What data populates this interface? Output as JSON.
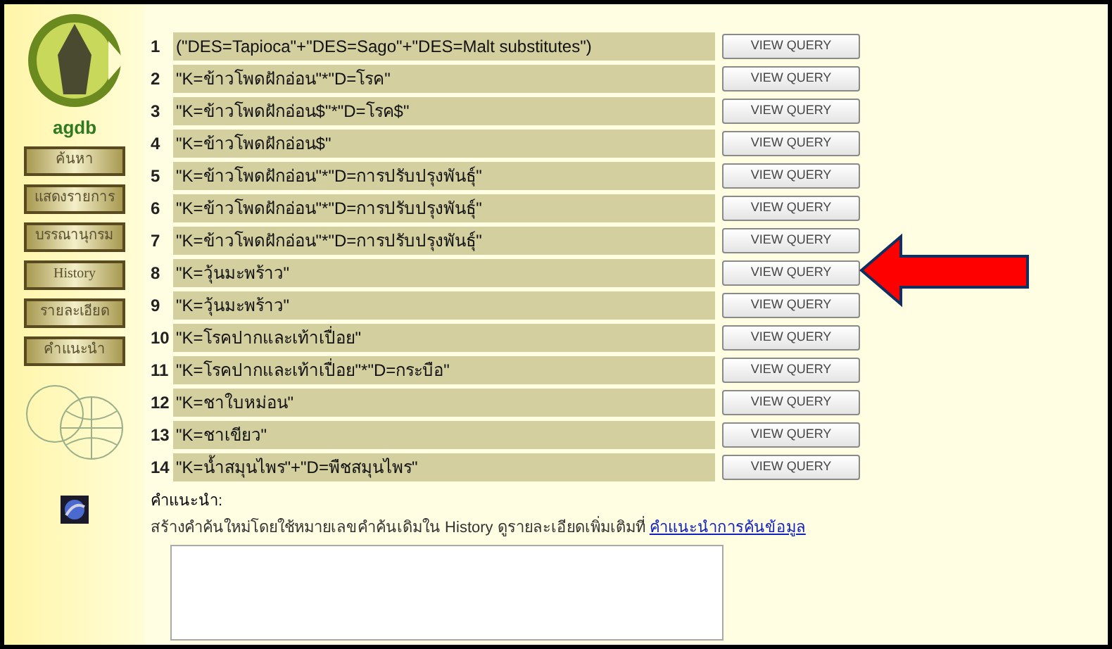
{
  "sidebar": {
    "site_name": "agdb",
    "items": [
      {
        "label": "ค้นหา"
      },
      {
        "label": "แสดงรายการ"
      },
      {
        "label": "บรรณานุกรม"
      },
      {
        "label": "History"
      },
      {
        "label": "รายละเอียด"
      },
      {
        "label": "คำแนะนำ"
      }
    ]
  },
  "queries": [
    {
      "number": "1",
      "text": "(\"DES=Tapioca\"+\"DES=Sago\"+\"DES=Malt substitutes\")",
      "button": "VIEW QUERY"
    },
    {
      "number": "2",
      "text": "\"K=ข้าวโพดฝักอ่อน\"*\"D=โรค\"",
      "button": "VIEW QUERY"
    },
    {
      "number": "3",
      "text": "\"K=ข้าวโพดฝักอ่อน$\"*\"D=โรค$\"",
      "button": "VIEW QUERY"
    },
    {
      "number": "4",
      "text": "\"K=ข้าวโพดฝักอ่อน$\"",
      "button": "VIEW QUERY"
    },
    {
      "number": "5",
      "text": "\"K=ข้าวโพดฝักอ่อน\"*\"D=การปรับปรุงพันธุ์\"",
      "button": "VIEW QUERY"
    },
    {
      "number": "6",
      "text": "\"K=ข้าวโพดฝักอ่อน\"*\"D=การปรับปรุงพันธุ์\"",
      "button": "VIEW QUERY"
    },
    {
      "number": "7",
      "text": "\"K=ข้าวโพดฝักอ่อน\"*\"D=การปรับปรุงพันธุ์\"",
      "button": "VIEW QUERY"
    },
    {
      "number": "8",
      "text": "\"K=วุ้นมะพร้าว\"",
      "button": "VIEW QUERY"
    },
    {
      "number": "9",
      "text": "\"K=วุ้นมะพร้าว\"",
      "button": "VIEW QUERY"
    },
    {
      "number": "10",
      "text": "\"K=โรคปากและเท้าเปื่อย\"",
      "button": "VIEW QUERY"
    },
    {
      "number": "11",
      "text": "\"K=โรคปากและเท้าเปื่อย\"*\"D=กระบือ\"",
      "button": "VIEW QUERY"
    },
    {
      "number": "12",
      "text": "\"K=ชาใบหม่อน\"",
      "button": "VIEW QUERY"
    },
    {
      "number": "13",
      "text": "\"K=ชาเขียว\"",
      "button": "VIEW QUERY"
    },
    {
      "number": "14",
      "text": "\"K=น้ำสมุนไพร\"+\"D=พืชสมุนไพร\"",
      "button": "VIEW QUERY"
    }
  ],
  "hint": {
    "label": "คำแนะนำ:",
    "text": "สร้างคำค้นใหม่โดยใช้หมายเลขคำค้นเดิมใน History ดูรายละเอียดเพิ่มเติมที่",
    "link": "คำแนะนำการค้นข้อมูล"
  }
}
